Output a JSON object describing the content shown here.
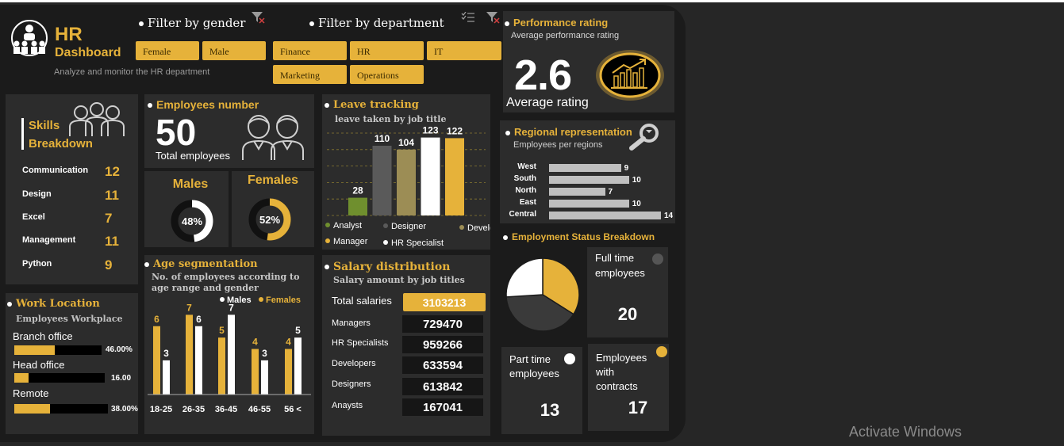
{
  "header": {
    "title_line1": "HR",
    "title_line2": "Dashboard",
    "subtitle": "Analyze and monitor the HR department"
  },
  "filters": {
    "gender_title": "Filter by gender",
    "gender_options": [
      "Female",
      "Male"
    ],
    "department_title": "Filter by department",
    "department_options": [
      "Finance",
      "HR",
      "IT",
      "Marketing",
      "Operations"
    ]
  },
  "performance": {
    "title": "Performance rating",
    "subtitle": "Average performance rating",
    "value": "2.6",
    "label": "Average rating"
  },
  "skills": {
    "title_line1": "Skills",
    "title_line2": "Breakdown",
    "items": [
      {
        "name": "Communication",
        "value": "12"
      },
      {
        "name": "Design",
        "value": "11"
      },
      {
        "name": "Excel",
        "value": "7"
      },
      {
        "name": "Management",
        "value": "11"
      },
      {
        "name": "Python",
        "value": "9"
      }
    ]
  },
  "employees": {
    "title": "Employees number",
    "value": "50",
    "label": "Total employees"
  },
  "gender_split": {
    "males_title": "Males",
    "males_pct_label": "48%",
    "males_fraction": 0.48,
    "females_title": "Females",
    "females_pct_label": "52%",
    "females_fraction": 0.52
  },
  "leave": {
    "title": "Leave tracking",
    "subtitle": "leave taken by job title"
  },
  "age": {
    "title": "Age segmentation",
    "subtitle": "No. of employees according to age range and gender"
  },
  "salary": {
    "title": "Salary distribution",
    "subtitle": "Salary amount by job titles",
    "total_label": "Total salaries",
    "total_value": "3103213",
    "rows": [
      {
        "label": "Managers",
        "value": "729470"
      },
      {
        "label": "HR Specialists",
        "value": "959266"
      },
      {
        "label": "Developers",
        "value": "633594"
      },
      {
        "label": "Designers",
        "value": "613842"
      },
      {
        "label": "Anaysts",
        "value": "167041"
      }
    ]
  },
  "regional": {
    "title": "Regional representation",
    "subtitle": "Employees per regions"
  },
  "employment": {
    "title": "Employment  Status Breakdown",
    "full_time_label": "Full time employees",
    "full_time_value": "20",
    "part_time_label": "Part time employees",
    "part_time_value": "13",
    "contracts_label": "Employees with contracts",
    "contracts_value": "17"
  },
  "work_location": {
    "title": "Work Location",
    "subtitle": "Employees Workplace",
    "items": [
      {
        "name": "Branch office",
        "value_label": "46.00%",
        "fraction": 0.46
      },
      {
        "name": "Head office",
        "value_label": "16.00",
        "fraction": 0.16
      },
      {
        "name": "Remote",
        "value_label": "38.00%",
        "fraction": 0.38
      }
    ]
  },
  "watermark": {
    "text": "Activate Windows"
  },
  "chart_data": [
    {
      "type": "bar",
      "title": "Leave tracking",
      "subtitle": "leave taken by job title",
      "categories": [
        "Analyst",
        "Designer",
        "Developer",
        "Manager",
        "HR Specialist"
      ],
      "values": [
        28,
        110,
        104,
        123,
        122
      ],
      "colors": [
        "#6f8f2e",
        "#5a5a5a",
        "#9c8d55",
        "#ffffff",
        "#e6b23a"
      ],
      "ylim": [
        0,
        130
      ],
      "grid": true,
      "legend": "bottom"
    },
    {
      "type": "bar",
      "title": "Age segmentation",
      "subtitle": "No. of employees according to age range and gender",
      "categories": [
        "18-25",
        "26-35",
        "36-45",
        "46-55",
        "56 <"
      ],
      "series": [
        {
          "name": "Males",
          "values": [
            3,
            6,
            7,
            3,
            5
          ],
          "color": "#ffffff"
        },
        {
          "name": "Females",
          "values": [
            6,
            7,
            5,
            4,
            4
          ],
          "color": "#e6b23a"
        }
      ],
      "ylim": [
        0,
        8
      ],
      "legend": "top-right"
    },
    {
      "type": "bar",
      "title": "Regional representation",
      "subtitle": "Employees per regions",
      "orientation": "horizontal",
      "categories": [
        "West",
        "South",
        "North",
        "East",
        "Central"
      ],
      "values": [
        9,
        10,
        7,
        10,
        14
      ],
      "xlim": [
        0,
        14
      ],
      "color": "#bfbfbf"
    },
    {
      "type": "pie",
      "title": "Employment  Status Breakdown",
      "categories": [
        "Full time employees",
        "Part time employees",
        "Employees with contracts"
      ],
      "values": [
        20,
        13,
        17
      ],
      "colors": [
        "#3a3a3a",
        "#ffffff",
        "#e6b23a"
      ]
    }
  ]
}
